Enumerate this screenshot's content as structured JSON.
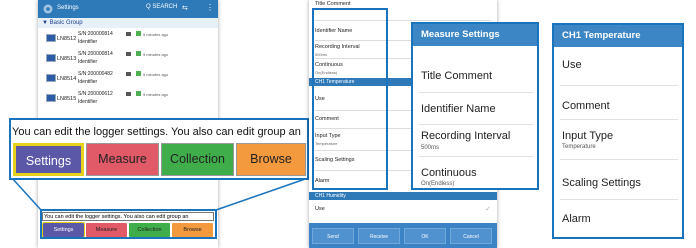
{
  "phone1": {
    "title": "Settings",
    "search_label": "Q SEARCH",
    "group": "▼ Basic Group",
    "loggers": [
      {
        "name": "LN8512",
        "sn": "S/N:200000814",
        "id": "Identifier",
        "status": "9 minutes ago"
      },
      {
        "name": "LN8513",
        "sn": "S/N:200000814",
        "id": "Identifier",
        "status": "9 minutes ago"
      },
      {
        "name": "LN8514",
        "sn": "S/N:200000482",
        "id": "Identifier",
        "status": "9 minutes ago"
      },
      {
        "name": "LN8515",
        "sn": "S/N:200000612",
        "id": "Identifier",
        "status": "9 minutes ago"
      }
    ],
    "tip": "You can edit the logger settings. You also can edit group an",
    "tabs": [
      "Settings",
      "Measure",
      "Collection",
      "Browse"
    ]
  },
  "zoom": {
    "text": "You can edit the logger settings. You also can edit group an",
    "tabs": [
      "Settings",
      "Measure",
      "Collection",
      "Browse"
    ]
  },
  "tab_colors": {
    "settings": "#5b58a7",
    "measure": "#e05a67",
    "collection": "#3fae4a",
    "browse": "#f39a3f",
    "highlight": "#e6d21c"
  },
  "phone2": {
    "rows": [
      {
        "label": "Title Comment",
        "sub": ""
      },
      {
        "label": "Identifier Name",
        "sub": ""
      },
      {
        "label": "Recording Interval",
        "sub": "500ms"
      },
      {
        "label": "Continuous",
        "sub": "On(Endless)"
      }
    ],
    "ch1_header": "CH1 Temperature",
    "ch1_rows": [
      {
        "label": "Use",
        "sub": ""
      },
      {
        "label": "Comment",
        "sub": ""
      },
      {
        "label": "Input Type",
        "sub": "Temperature"
      },
      {
        "label": "Scaling Settings",
        "sub": ""
      },
      {
        "label": "Alarm",
        "sub": ""
      }
    ],
    "humidity_header": "CH1 Humidity",
    "humidity_row": "Use",
    "buttons": [
      "Send",
      "Receive",
      "OK",
      "Cancel"
    ]
  },
  "panel_measure": {
    "header": "Measure Settings",
    "items": [
      {
        "label": "Title Comment",
        "sub": ""
      },
      {
        "label": "Identifier Name",
        "sub": ""
      },
      {
        "label": "Recording Interval",
        "sub": "500ms"
      },
      {
        "label": "Continuous",
        "sub": "On(Endless)"
      }
    ]
  },
  "panel_ch1": {
    "header": "CH1 Temperature",
    "items": [
      {
        "label": "Use",
        "sub": ""
      },
      {
        "label": "Comment",
        "sub": ""
      },
      {
        "label": "Input Type",
        "sub": "Temperature"
      },
      {
        "label": "Scaling Settings",
        "sub": ""
      },
      {
        "label": "Alarm",
        "sub": ""
      }
    ]
  }
}
